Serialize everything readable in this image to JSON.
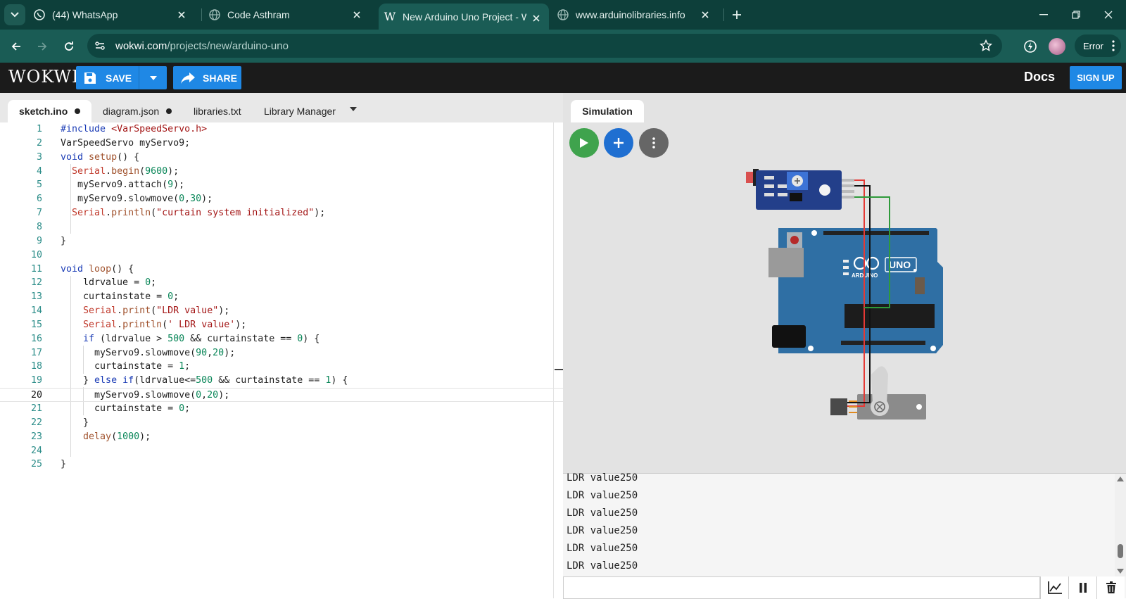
{
  "browser": {
    "tabs": [
      {
        "label": "(44) WhatsApp",
        "favicon": "whatsapp-icon"
      },
      {
        "label": "Code Asthram",
        "favicon": "globe-icon"
      },
      {
        "label": "New Arduino Uno Project - Wol",
        "favicon": "wokwi-icon"
      },
      {
        "label": "www.arduinolibraries.info",
        "favicon": "globe-icon"
      }
    ],
    "url_host": "wokwi.com",
    "url_path": "/projects/new/arduino-uno",
    "profile_status": "Error"
  },
  "header": {
    "logo": "WOKWI",
    "save_label": "SAVE",
    "share_label": "SHARE",
    "docs_label": "Docs",
    "signup_label": "SIGN UP"
  },
  "editor": {
    "tabs": [
      {
        "label": "sketch.ino",
        "modified": true
      },
      {
        "label": "diagram.json",
        "modified": true
      },
      {
        "label": "libraries.txt",
        "modified": false
      },
      {
        "label": "Library Manager",
        "modified": false
      }
    ],
    "current_line": 20,
    "lines": [
      "#include <VarSpeedServo.h>",
      "VarSpeedServo myServo9;",
      "void setup() {",
      "  Serial.begin(9600);",
      "   myServo9.attach(9);",
      "   myServo9.slowmove(0,30);",
      "  Serial.println(\"curtain system initialized\");",
      "",
      "}",
      "",
      "void loop() {",
      "    ldrvalue = 0;",
      "    curtainstate = 0;",
      "    Serial.print(\"LDR value\");",
      "    Serial.println(' LDR value');",
      "    if (ldrvalue > 500 && curtainstate == 0) {",
      "      myServo9.slowmove(90,20);",
      "      curtainstate = 1;",
      "    } else if(ldrvalue<=500 && curtainstate == 1) {",
      "      myServo9.slowmove(0,20);",
      "      curtainstate = 0;",
      "    }",
      "    delay(1000);",
      "",
      "}"
    ]
  },
  "simulation": {
    "tab_label": "Simulation",
    "board_label": "UNO",
    "brand_label": "ARDUINO",
    "serial_lines": [
      "LDR value250",
      "LDR value250",
      "LDR value250",
      "LDR value250",
      "LDR value250",
      "LDR value250"
    ],
    "serial_input": ""
  },
  "colors": {
    "accent": "#1f88e5",
    "play": "#3fa34d",
    "chrome": "#1a5c55"
  }
}
